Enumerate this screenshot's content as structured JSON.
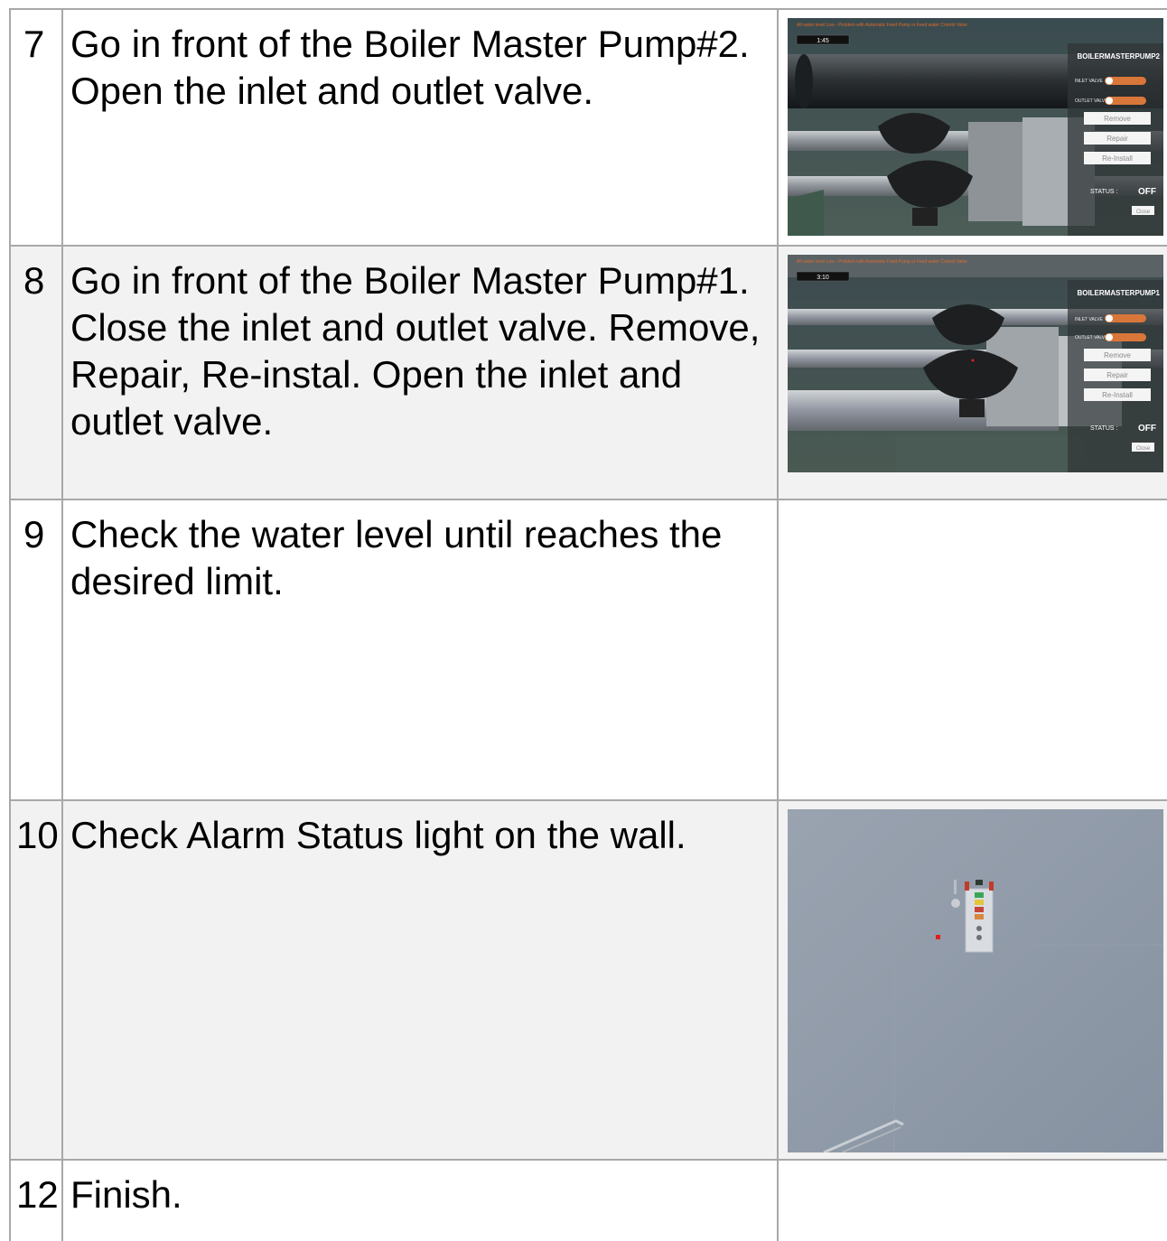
{
  "rows": [
    {
      "num": "7",
      "text": "Go in front of the Boiler Master Pump#2. Open the inlet and outlet valve.",
      "screenshot": {
        "alert": "Alt water level Low - Problem with Automatic Feed Pump or Feed water Control Valve",
        "timer": "1:45",
        "panel_title": "BOILERMASTERPUMP2",
        "inlet_label": "INLET VALVE",
        "outlet_label": "OUTLET VALVE",
        "inlet_level": 0,
        "outlet_level": 0,
        "buttons": [
          "Remove",
          "Repair",
          "Re-Install"
        ],
        "status_label": "STATUS :",
        "status_value": "OFF",
        "close_label": "Close"
      }
    },
    {
      "num": "8",
      "text": "Go in front of the Boiler Master Pump#1. Close the inlet and outlet valve. Remove, Repair, Re-instal. Open the inlet and outlet valve.",
      "screenshot": {
        "alert": "Alt water level Low - Problem with Automatic Feed Pump or Feed water Control Valve",
        "timer": "3:10",
        "panel_title": "BOILERMASTERPUMP1",
        "inlet_label": "INLET VALVE",
        "outlet_label": "OUTLET VALVE",
        "inlet_level": 1,
        "outlet_level": 1,
        "buttons": [
          "Remove",
          "Repair",
          "Re-Install"
        ],
        "status_label": "STATUS :",
        "status_value": "OFF",
        "close_label": "Close"
      }
    },
    {
      "num": "9",
      "text": "Check the water level until reaches the desired limit."
    },
    {
      "num": "10",
      "text": "Check Alarm Status light on the wall."
    },
    {
      "num": "12",
      "text": "Finish."
    }
  ],
  "colors": {
    "row_shade": "#f2f2f2",
    "border": "#a8a8a8",
    "toggle_orange": "#d9773a",
    "alert_text": "#e06a2a",
    "wall": "#8f9aa9"
  }
}
